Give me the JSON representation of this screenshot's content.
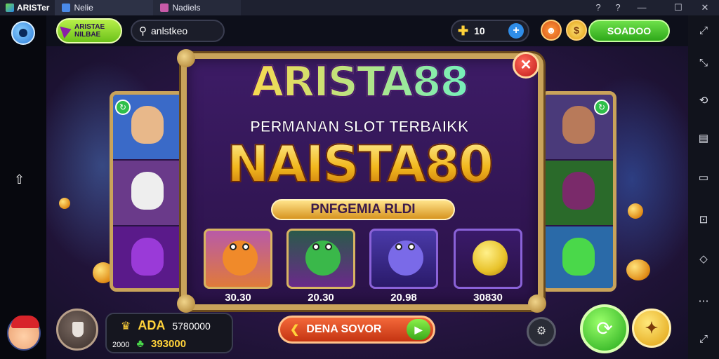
{
  "window": {
    "app_title": "ARISTer",
    "tabs": [
      {
        "label": "Nelie",
        "active": true
      },
      {
        "label": "Nadiels",
        "active": false
      }
    ],
    "controls": [
      "?",
      "?",
      "—",
      "☐",
      "✕"
    ]
  },
  "hud": {
    "logo_text_1": "ARISTAE",
    "logo_text_2": "NILBAE",
    "search_value": "anlstkeo",
    "coins_value": "10",
    "green_button_label": "SOADOO"
  },
  "banner": {
    "brand": "ARISTA88",
    "subtitle": "PERMANAN SLOT TERBAIKK",
    "headline": "NAISTA80",
    "tagline": "PNFGEMIA RLDI"
  },
  "games": [
    {
      "value": "30.30",
      "color": "#f08a2a"
    },
    {
      "value": "20.30",
      "color": "#3ab84a"
    },
    {
      "value": "20.98",
      "color": "#7a6ae8"
    },
    {
      "value": "30830",
      "color": "#e8c22a"
    }
  ],
  "bottom": {
    "stat_1_label": "ADA",
    "stat_1_value": "5780000",
    "stat_2_label": "2000",
    "stat_2_value": "393000",
    "play_label": "DENA SOVOR"
  },
  "colors": {
    "accent_gold": "#c9a35a",
    "accent_green": "#2ea81a",
    "background": "#2b1648"
  }
}
